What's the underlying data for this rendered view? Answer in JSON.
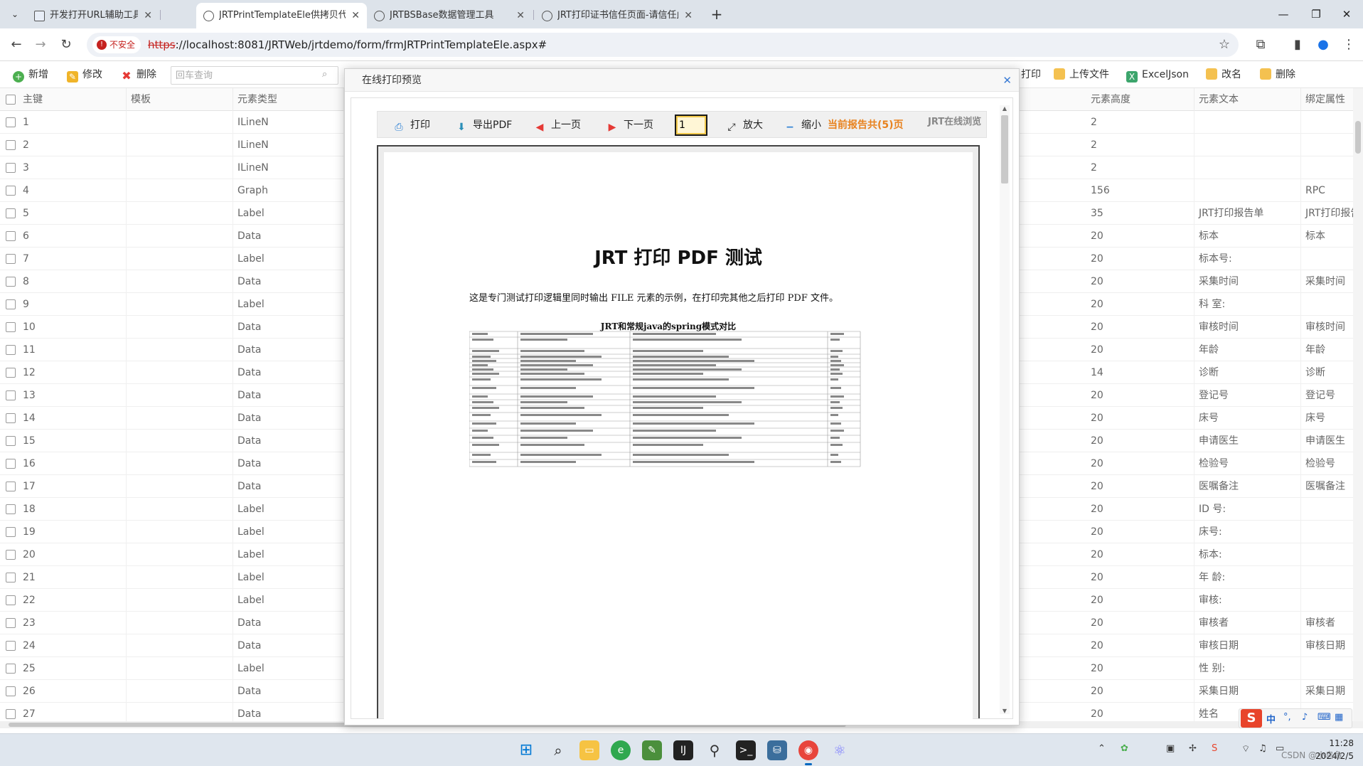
{
  "browser": {
    "tabs": [
      {
        "title": "开发打开URL辅助工具",
        "favicon": "page-icon"
      },
      {
        "title": "JRTPrintTemplateEle供拷贝代码",
        "favicon": "globe-icon"
      },
      {
        "title": "JRTBSBase数据管理工具",
        "favicon": "globe-icon"
      },
      {
        "title": "JRT打印证书信任页面-请信任此证书",
        "favicon": "globe-icon"
      }
    ],
    "active_tab": 1,
    "security_label": "不安全",
    "url_scheme": "https",
    "url_rest": "://localhost:8081/JRTWeb/jrtdemo/form/frmJRTPrintTemplateEle.aspx#"
  },
  "toolbar": {
    "add": "新增",
    "edit": "修改",
    "delete": "删除",
    "search_placeholder": "回车查询",
    "print_partial": "打印",
    "upload": "上传文件",
    "excel_json": "ExcelJson",
    "rename": "改名",
    "delete2": "删除"
  },
  "grid": {
    "headers": {
      "pk": "主键",
      "template": "模板",
      "element_type": "元素类型",
      "height": "元素高度",
      "text": "元素文本",
      "bind": "绑定属性"
    },
    "rows": [
      {
        "pk": "1",
        "type": "ILineN",
        "height": "2",
        "text": "",
        "bind": ""
      },
      {
        "pk": "2",
        "type": "ILineN",
        "height": "2",
        "text": "",
        "bind": ""
      },
      {
        "pk": "3",
        "type": "ILineN",
        "height": "2",
        "text": "",
        "bind": ""
      },
      {
        "pk": "4",
        "type": "Graph",
        "height": "156",
        "text": "",
        "bind": "RPC"
      },
      {
        "pk": "5",
        "type": "Label",
        "height": "35",
        "text": "JRT打印报告单",
        "bind": "JRT打印报告"
      },
      {
        "pk": "6",
        "type": "Data",
        "height": "20",
        "text": "标本",
        "bind": "标本"
      },
      {
        "pk": "7",
        "type": "Label",
        "height": "20",
        "text": "标本号:",
        "bind": ""
      },
      {
        "pk": "8",
        "type": "Data",
        "height": "20",
        "text": "采集时间",
        "bind": "采集时间"
      },
      {
        "pk": "9",
        "type": "Label",
        "height": "20",
        "text": "科 室:",
        "bind": ""
      },
      {
        "pk": "10",
        "type": "Data",
        "height": "20",
        "text": "审核时间",
        "bind": "审核时间"
      },
      {
        "pk": "11",
        "type": "Data",
        "height": "20",
        "text": "年龄",
        "bind": "年龄"
      },
      {
        "pk": "12",
        "type": "Data",
        "height": "14",
        "text": "诊断",
        "bind": "诊断"
      },
      {
        "pk": "13",
        "type": "Data",
        "height": "20",
        "text": "登记号",
        "bind": "登记号"
      },
      {
        "pk": "14",
        "type": "Data",
        "height": "20",
        "text": "床号",
        "bind": "床号"
      },
      {
        "pk": "15",
        "type": "Data",
        "height": "20",
        "text": "申请医生",
        "bind": "申请医生"
      },
      {
        "pk": "16",
        "type": "Data",
        "height": "20",
        "text": "检验号",
        "bind": "检验号"
      },
      {
        "pk": "17",
        "type": "Data",
        "height": "20",
        "text": "医嘱备注",
        "bind": "医嘱备注"
      },
      {
        "pk": "18",
        "type": "Label",
        "height": "20",
        "text": "ID 号:",
        "bind": ""
      },
      {
        "pk": "19",
        "type": "Label",
        "height": "20",
        "text": "床号:",
        "bind": ""
      },
      {
        "pk": "20",
        "type": "Label",
        "height": "20",
        "text": "标本:",
        "bind": ""
      },
      {
        "pk": "21",
        "type": "Label",
        "height": "20",
        "text": "年 龄:",
        "bind": ""
      },
      {
        "pk": "22",
        "type": "Label",
        "height": "20",
        "text": "审核:",
        "bind": ""
      },
      {
        "pk": "23",
        "type": "Data",
        "height": "20",
        "text": "审核者",
        "bind": "审核者"
      },
      {
        "pk": "24",
        "type": "Data",
        "height": "20",
        "text": "审核日期",
        "bind": "审核日期"
      },
      {
        "pk": "25",
        "type": "Label",
        "height": "20",
        "text": "性 别:",
        "bind": ""
      },
      {
        "pk": "26",
        "type": "Data",
        "height": "20",
        "text": "采集日期",
        "bind": "采集日期"
      },
      {
        "pk": "27",
        "type": "Data",
        "height": "20",
        "text": "姓名",
        "bind": ""
      }
    ]
  },
  "modal": {
    "title": "在线打印预览",
    "viewer": {
      "print": "打印",
      "export_pdf": "导出PDF",
      "prev": "上一页",
      "next": "下一页",
      "page_value": "1",
      "zoom_in": "放大",
      "zoom_out": "缩小",
      "page_info": "当前报告共(5)页",
      "name": "JRT在线浏览"
    },
    "document": {
      "title": "JRT 打印 PDF 测试",
      "paragraph": "这是专门测试打印逻辑里同时输出 FILE 元素的示例，在打印完其他之后打印 PDF 文件。",
      "embedded_table_title": "JRT和常规java的spring模式对比"
    }
  },
  "taskbar": {
    "ime_label": "中",
    "clock_time": "11:28",
    "clock_date": "2024/2/5",
    "watermark": "CSDN @小乌鱼"
  },
  "colors": {
    "page_info": "#e8821e",
    "insecure": "#c5221f",
    "modal_close": "#3a7bd5",
    "ime_brand": "#e8442b"
  }
}
